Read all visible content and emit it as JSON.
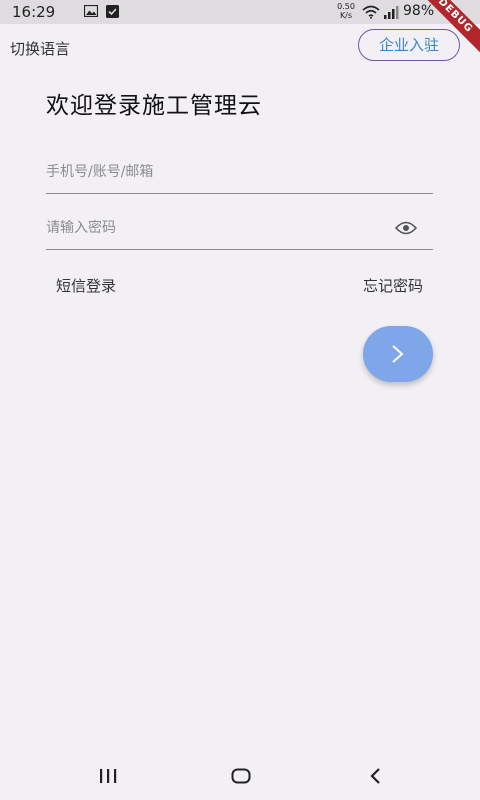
{
  "status_bar": {
    "time": "16:29",
    "net_speed_value": "0.50",
    "net_speed_unit": "K/s",
    "battery": "98%",
    "icons": [
      "image-icon",
      "check-icon",
      "wifi-icon",
      "signal-icon"
    ]
  },
  "debug_banner": "DEBUG",
  "header": {
    "lang_switch": "切换语言",
    "enterprise_button": "企业入驻"
  },
  "welcome_title": "欢迎登录施工管理云",
  "form": {
    "account_placeholder": "手机号/账号/邮箱",
    "account_value": "",
    "password_placeholder": "请输入密码",
    "password_value": ""
  },
  "links": {
    "sms_login": "短信登录",
    "forgot_password": "忘记密码"
  },
  "colors": {
    "background": "#f2f0f5",
    "accent_button": "#7ea6e8",
    "enterprise_text": "#3a85d0",
    "enterprise_border": "#6a5aa0",
    "debug_banner": "#b1272d"
  },
  "nav_bar": {
    "icons": [
      "recents-icon",
      "home-icon",
      "back-icon"
    ]
  }
}
